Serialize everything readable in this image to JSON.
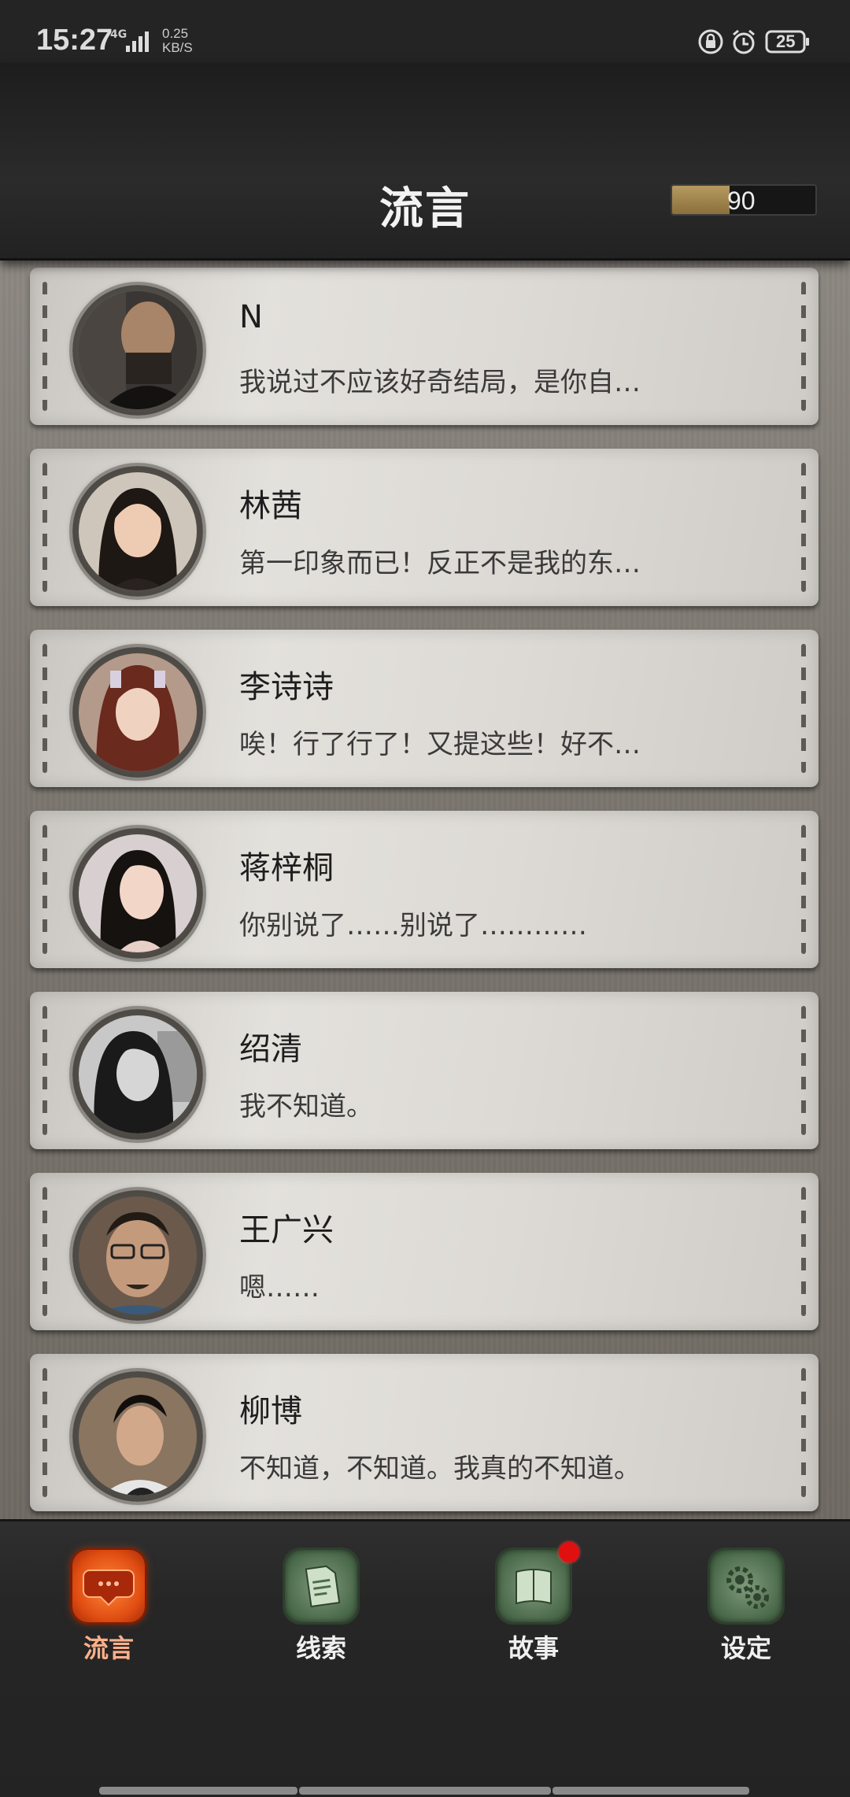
{
  "status_bar": {
    "time": "15:27",
    "network": "4G",
    "speed_top": "0.25",
    "speed_bottom": "KB/S",
    "battery": "25",
    "icons": [
      "lock-rotation-icon",
      "alarm-icon"
    ]
  },
  "header": {
    "title": "流言",
    "coins": "90",
    "coin_fill_fraction": 0.4
  },
  "messages": [
    {
      "name": "N",
      "text": "我说过不应该好奇结局，是你自…"
    },
    {
      "name": "林茜",
      "text": "第一印象而已！反正不是我的东…"
    },
    {
      "name": "李诗诗",
      "text": "唉！行了行了！又提这些！好不…"
    },
    {
      "name": "蒋梓桐",
      "text": "你别说了……别说了…………"
    },
    {
      "name": "绍清",
      "text": "我不知道。"
    },
    {
      "name": "王广兴",
      "text": "嗯……"
    },
    {
      "name": "柳博",
      "text": "不知道，不知道。我真的不知道。"
    }
  ],
  "nav": [
    {
      "label": "流言",
      "icon": "chat-bubble-icon",
      "active": true
    },
    {
      "label": "线索",
      "icon": "document-icon",
      "active": false
    },
    {
      "label": "故事",
      "icon": "book-icon",
      "active": false,
      "badge": true
    },
    {
      "label": "设定",
      "icon": "gears-icon",
      "active": false
    }
  ],
  "colors": {
    "header_bg": "#1d1d1d",
    "card_bg": "#e3e1dc",
    "active_orange": "#e04d12",
    "inactive_green": "#4c6b4c",
    "badge_red": "#e01010"
  }
}
